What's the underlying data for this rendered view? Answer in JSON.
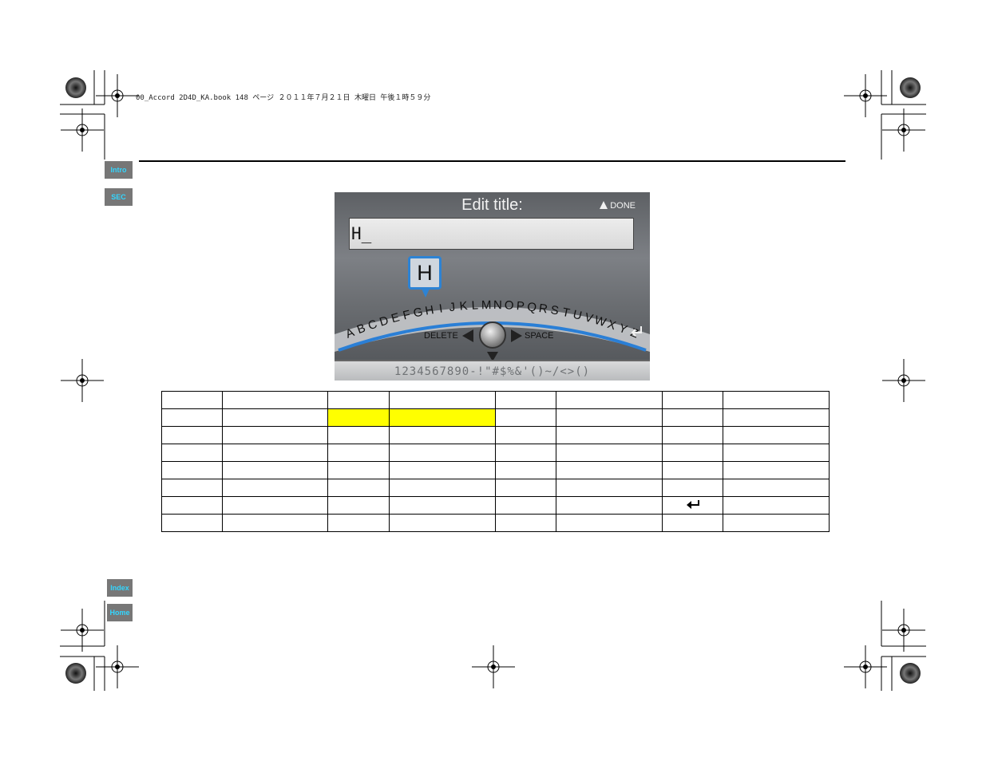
{
  "print_header": "00_Accord 2D4D_KA.book  148 ページ  ２０１１年７月２１日  木曜日  午後１時５９分",
  "nav": {
    "intro": "Intro",
    "sec": "SEC",
    "index": "Index",
    "home": "Home"
  },
  "screen": {
    "title": "Edit title:",
    "done_label": "DONE",
    "entry_text": "H_",
    "selected_letter": "H",
    "alphabet": [
      "A",
      "B",
      "C",
      "D",
      "E",
      "F",
      "G",
      "H",
      "I",
      "J",
      "K",
      "L",
      "M",
      "N",
      "O",
      "P",
      "Q",
      "R",
      "S",
      "T",
      "U",
      "V",
      "W",
      "X",
      "Y",
      "Z"
    ],
    "delete_label": "DELETE",
    "space_label": "SPACE",
    "symbols": "1234567890-!\"#$%&'()~/<>()"
  },
  "table": {
    "rows": [
      [
        "",
        "",
        "",
        "",
        "",
        "",
        "",
        ""
      ],
      [
        "",
        "",
        "",
        "",
        "",
        "",
        "",
        ""
      ],
      [
        "",
        "",
        "",
        "",
        "",
        "",
        "",
        ""
      ],
      [
        "",
        "",
        "",
        "",
        "",
        "",
        "",
        ""
      ],
      [
        "",
        "",
        "",
        "",
        "",
        "",
        "",
        ""
      ],
      [
        "",
        "",
        "",
        "",
        "",
        "",
        "",
        ""
      ],
      [
        "",
        "",
        "",
        "",
        "",
        "",
        "",
        ""
      ],
      [
        "",
        "",
        "",
        "",
        "",
        "",
        "",
        ""
      ]
    ],
    "highlighted_cells": [
      [
        1,
        2
      ],
      [
        1,
        3
      ]
    ],
    "enter_icon_cell": [
      6,
      6
    ]
  },
  "colors": {
    "highlight": "#ffff00",
    "nav_bg": "#777777",
    "nav_text": "#33d6ff",
    "selection_blue": "#2d83d4"
  }
}
